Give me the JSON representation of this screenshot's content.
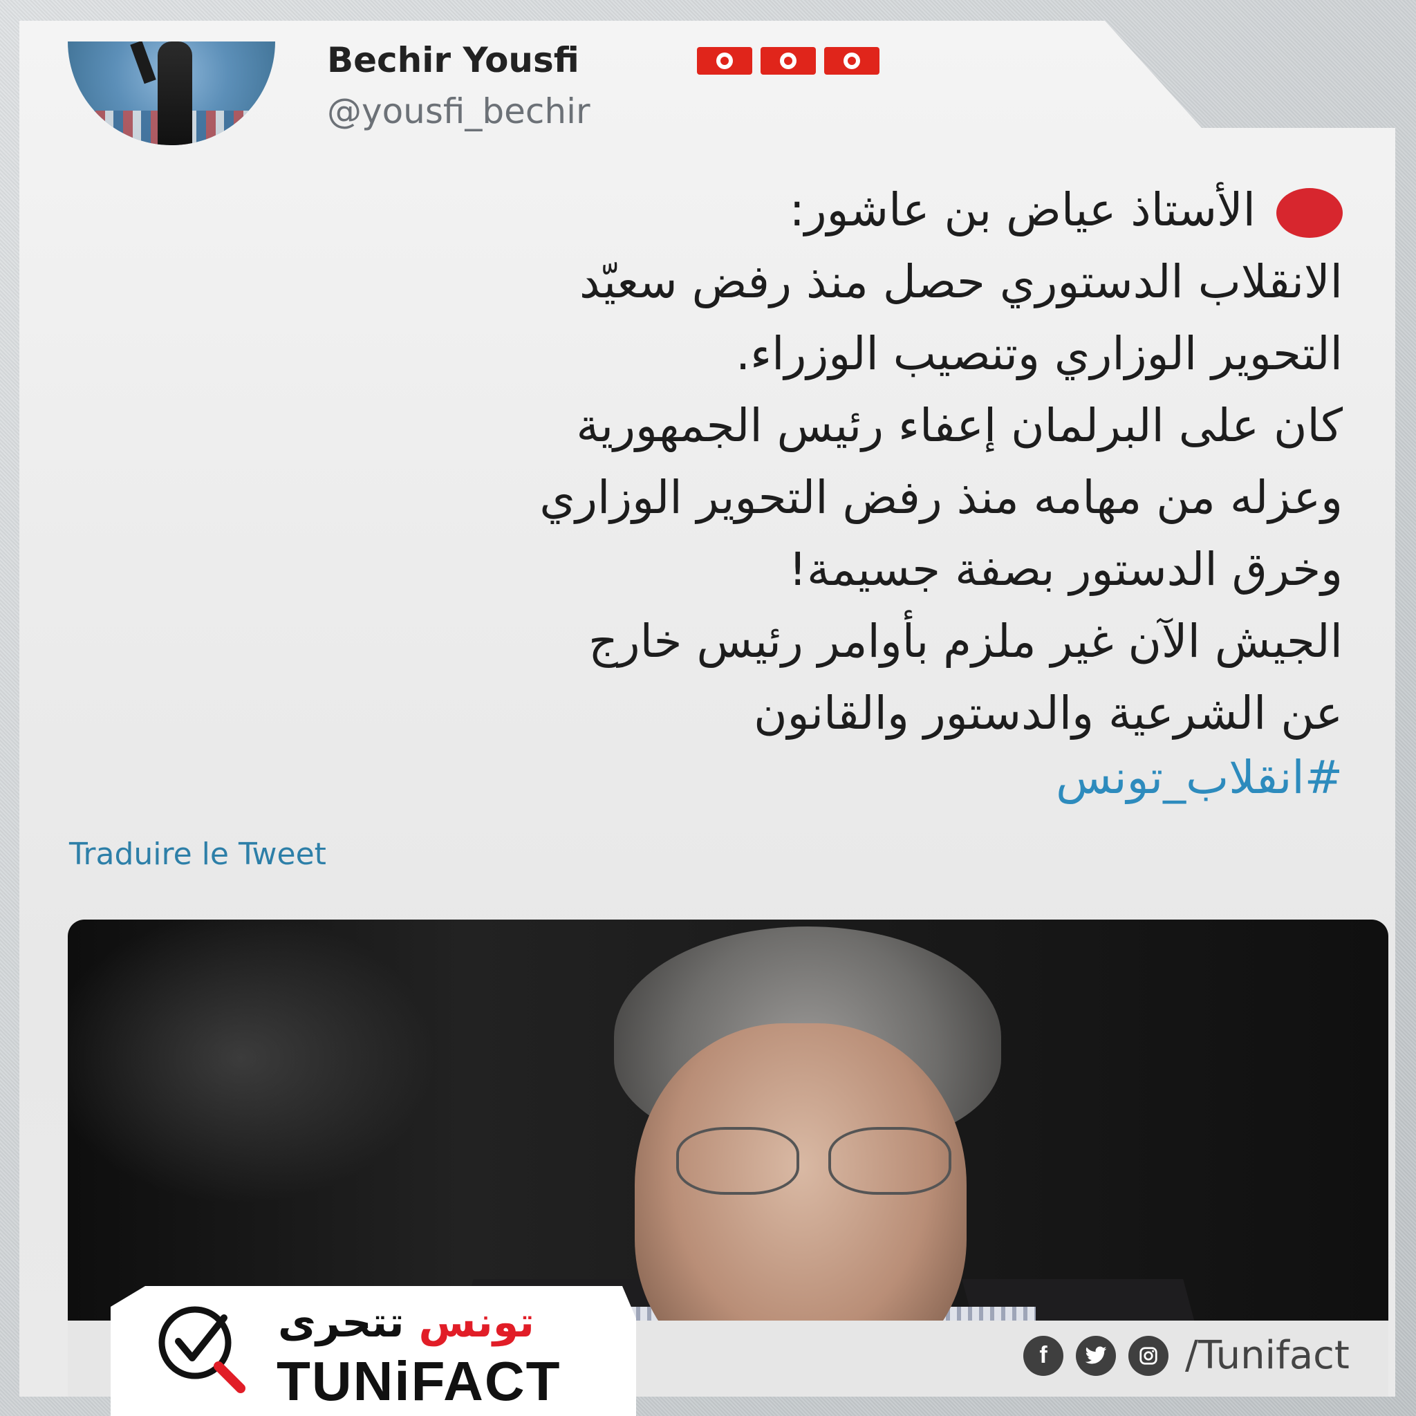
{
  "tweet": {
    "author_name": "Bechir Yousfi",
    "author_handle": "@yousfi_bechir",
    "flag_count": 3,
    "lines": [
      "الأستاذ عياض بن عاشور:",
      "الانقلاب الدستوري حصل منذ رفض سعيّد",
      "التحوير الوزاري وتنصيب الوزراء.",
      "كان على البرلمان إعفاء رئيس الجمهورية",
      "وعزله من مهامه منذ رفض التحوير الوزاري",
      "وخرق الدستور بصفة جسيمة!",
      "الجيش الآن غير ملزم بأوامر رئيس خارج",
      "عن الشرعية والدستور والقانون"
    ],
    "hashtag": "#انقلاب_تونس",
    "translate_label": "Traduire le Tweet"
  },
  "brand": {
    "arabic_part1": "تونس",
    "arabic_part2": "تتحرى",
    "latin": "TUNiFACT",
    "social_handle": "/Tunifact",
    "social_icons": [
      "facebook-icon",
      "twitter-icon",
      "instagram-icon"
    ]
  },
  "colors": {
    "red_dot": "#d7262e",
    "hashtag": "#2d8bbd",
    "translate": "#2d7fa8",
    "brand_red": "#e11d27"
  }
}
